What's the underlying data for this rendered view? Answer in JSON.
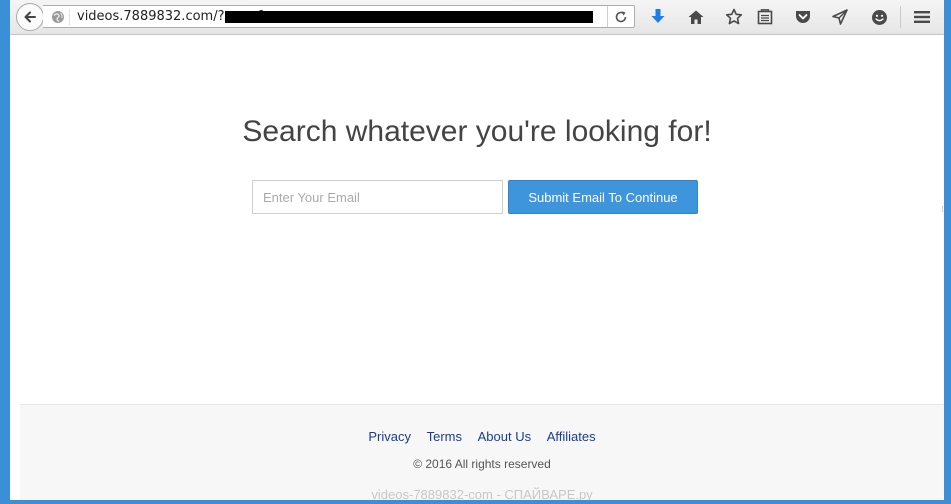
{
  "browser": {
    "url_visible": "videos.7889832.com/?sov=1",
    "toolbar_icons": [
      "back-arrow-icon",
      "globe-icon",
      "reload-icon",
      "download-icon",
      "home-icon",
      "bookmark-star-icon",
      "reading-list-icon",
      "pocket-icon",
      "send-icon",
      "smiley-icon",
      "hamburger-menu-icon"
    ]
  },
  "main": {
    "headline": "Search whatever you're looking for!",
    "email_placeholder": "Enter Your Email",
    "email_value": "",
    "submit_label": "Submit Email To Continue"
  },
  "footer": {
    "links": [
      "Privacy",
      "Terms",
      "About Us",
      "Affiliates"
    ],
    "copyright": "© 2016 All rights reserved",
    "watermark": "videos-7889832-com - СПАЙВАРЕ.ру"
  },
  "colors": {
    "accent": "#3e95dc",
    "link": "#1a3c96",
    "download_icon": "#1f7ee6",
    "desktop_background": "#3a8fd6"
  }
}
